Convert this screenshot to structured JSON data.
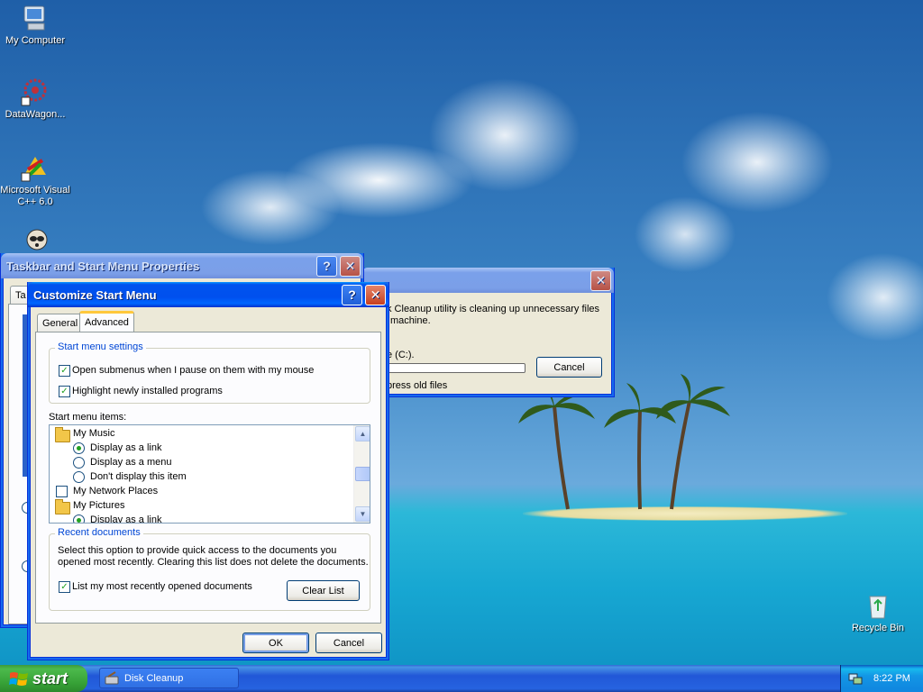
{
  "desktop": {
    "icons": [
      {
        "label": "My Computer"
      },
      {
        "label": "DataWagon..."
      },
      {
        "label": "Microsoft Visual C++ 6.0"
      },
      {
        "label": ""
      },
      {
        "label": "Recycle Bin"
      }
    ]
  },
  "taskbar_props": {
    "title": "Taskbar and Start Menu Properties",
    "tab_fragment": "Ta"
  },
  "disk_cleanup": {
    "message_line1": "k Cleanup utility is cleaning up unnecessary files",
    "message_line2": "machine.",
    "drive_text": "e  (C:).",
    "status_text": "press old files",
    "cancel_label": "Cancel"
  },
  "customize": {
    "title": "Customize Start Menu",
    "tabs": [
      {
        "label": "General"
      },
      {
        "label": "Advanced"
      }
    ],
    "start_settings": {
      "label": "Start menu settings",
      "options": [
        {
          "label": "Open submenus when I pause on them with my mouse",
          "checked": true
        },
        {
          "label": "Highlight newly installed programs",
          "checked": true
        }
      ]
    },
    "items_label": "Start menu items:",
    "items": [
      {
        "label": "My Music"
      },
      {
        "label": "Display as a link",
        "selected": true
      },
      {
        "label": "Display as a menu",
        "selected": false
      },
      {
        "label": "Don't display this item",
        "selected": false
      },
      {
        "label": "My Network Places",
        "checked": false
      },
      {
        "label": "My Pictures"
      },
      {
        "label": "Display as a link",
        "selected": true
      }
    ],
    "recent": {
      "label": "Recent documents",
      "description_line1": "Select this option to provide quick access to the documents you",
      "description_line2": "opened most recently.  Clearing this list does not delete the documents.",
      "list_option": "List my most recently opened documents",
      "list_checked": true,
      "clear_label": "Clear List"
    },
    "ok_label": "OK",
    "cancel_label": "Cancel"
  },
  "taskbar": {
    "start_label": "start",
    "task_label": "Disk Cleanup",
    "clock": "8:22 PM"
  },
  "glyphs": {
    "help": "?",
    "close": "✕",
    "check": "✓",
    "up": "▲",
    "down": "▼"
  }
}
